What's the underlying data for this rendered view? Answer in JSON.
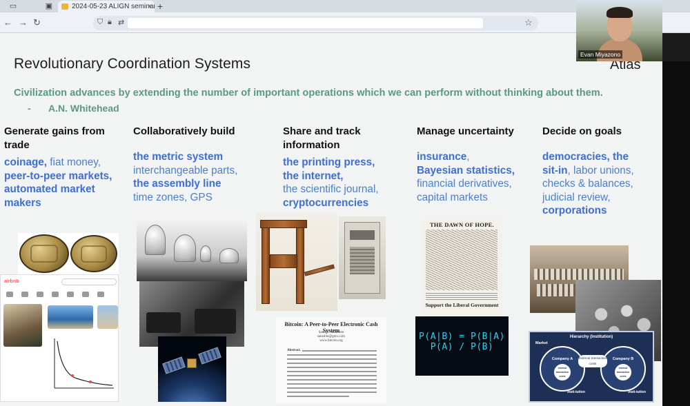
{
  "browser": {
    "tab_title": "2024-05-23 ALIGN seminar - G",
    "tab_close": "×",
    "new_tab": "+",
    "nav_back": "←",
    "nav_forward": "→",
    "nav_reload": "↻",
    "bookmark": "☆"
  },
  "video": {
    "participant_name": "Evan Miyazono"
  },
  "slide": {
    "title": "Revolutionary Coordination Systems",
    "brand": "Atlas",
    "quote": "Civilization advances by extending the number of important operations which we can perform without thinking about them.",
    "quote_dash": "-",
    "quote_author": "A.N. Whitehead",
    "columns": [
      {
        "heading_1": "Generate gains from",
        "heading_2": "trade",
        "l1_bold": "coinage,",
        "l1_rest": " fiat money,",
        "l2_bold": "peer-to-peer markets,",
        "l3_bold": "automated market",
        "l4_bold": "makers"
      },
      {
        "heading_1": "Collaboratively build",
        "l1_bold": "the metric system",
        "l2_rest": "interchangeable parts,",
        "l3_bold": "the assembly line",
        "l4_rest": "time zones, GPS"
      },
      {
        "heading_1": "Share and track",
        "heading_2": "information",
        "l1_bold": "the printing press,",
        "l2_bold": "the internet,",
        "l3_rest": "the scientific journal,",
        "l4_bold": "cryptocurrencies"
      },
      {
        "heading_1": "Manage uncertainty",
        "l1_bold": "insurance",
        "l1_rest": ",",
        "l2_bold": "Bayesian statistics,",
        "l3_rest": "financial derivatives,",
        "l4_rest": "capital markets"
      },
      {
        "heading_1": "Decide on goals",
        "l1_bold": "democracies, the",
        "l2_bold": "sit-in",
        "l2_rest": ", labor unions,",
        "l3_rest": "checks & balances,",
        "l4_rest": "judicial review,",
        "l5_bold": "corporations"
      }
    ],
    "images": {
      "airbnb_logo": "airbnb",
      "bitcoin_title": "Bitcoin: A Peer-to-Peer Electronic Cash System",
      "bitcoin_author": "Satoshi Nakamoto",
      "bitcoin_email": "satoshin@gmx.com",
      "bitcoin_site": "www.bitcoin.org",
      "bitcoin_abstract_label": "Abstract.",
      "dawn_title": "THE DAWN OF HOPE.",
      "dawn_caption": "Support the Liberal Government",
      "bayes_formula": "P(A|B) = P(B|A) P(A) / P(B)",
      "hier_title": "Hierarchy (Institution)",
      "hier_market": "Market",
      "hier_company_a": "Company A",
      "hier_company_b": "Company B",
      "hier_external": "external transaction costs",
      "hier_internal": "internal transaction costs",
      "hier_institution": "Insti-tution"
    }
  }
}
